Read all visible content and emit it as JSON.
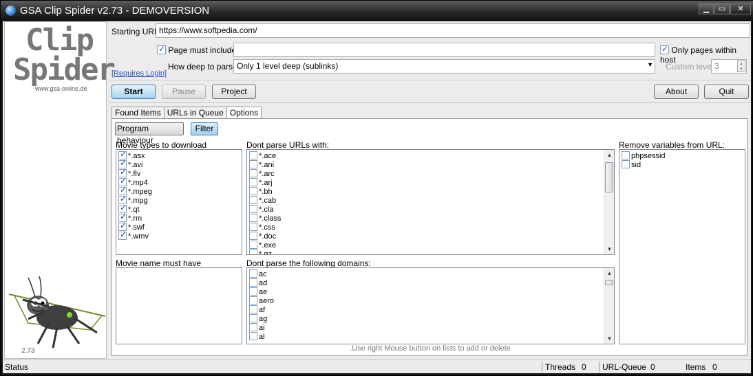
{
  "window": {
    "title": "GSA Clip Spider v2.73 - DEMOVERSION",
    "controls": [
      "minimize",
      "maximize",
      "close"
    ]
  },
  "logo": {
    "line1": "Clip",
    "line2": "Spider",
    "site": "www.gsa-online.de",
    "version": "2.73"
  },
  "settings": {
    "starting_url_label": "Starting URL",
    "starting_url_value": "https://www.softpedia.com/",
    "page_must_include_label": "Page must include",
    "page_must_include_checked": true,
    "page_must_include_value": "",
    "only_pages_within_host_label": "Only pages within host",
    "only_pages_within_host_checked": true,
    "requires_login_link": "[Requires Login]",
    "how_deep_label": "How deep to parse",
    "how_deep_value": "Only 1 level deep (sublinks)",
    "custom_level_label": "Custom level",
    "custom_level_value": "3"
  },
  "toolbar": {
    "start": "Start",
    "pause": "Pause",
    "project": "Project",
    "about": "About",
    "quit": "Quit"
  },
  "tabs": [
    {
      "label": "Found Items",
      "active": false
    },
    {
      "label": "URLs in Queue",
      "active": false
    },
    {
      "label": "Options",
      "active": true
    }
  ],
  "options": {
    "subtabs": [
      "Program behaviour",
      "Filter"
    ],
    "movie_types_label": "Movie types to download",
    "movie_types": [
      {
        "label": "*.asx",
        "checked": true
      },
      {
        "label": "*.avi",
        "checked": true
      },
      {
        "label": "*.flv",
        "checked": true
      },
      {
        "label": "*.mp4",
        "checked": true
      },
      {
        "label": "*.mpeg",
        "checked": true
      },
      {
        "label": "*.mpg",
        "checked": true
      },
      {
        "label": "*.qt",
        "checked": true
      },
      {
        "label": "*.rm",
        "checked": true
      },
      {
        "label": "*.swf",
        "checked": true
      },
      {
        "label": "*.wmv",
        "checked": true
      }
    ],
    "dont_parse_urls_label": "Dont parse URLs with:",
    "dont_parse_urls": [
      "*.ace",
      "*.ani",
      "*.arc",
      "*.arj",
      "*.bh",
      "*.cab",
      "*.cla",
      "*.class",
      "*.css",
      "*.doc",
      "*.exe",
      "*.gz"
    ],
    "remove_variables_label": "Remove variables from URL:",
    "remove_variables": [
      "phpsessid",
      "sid"
    ],
    "movie_name_label": "Movie name must have",
    "dont_parse_domains_label": "Dont parse the following domains:",
    "dont_parse_domains": [
      "ac",
      "ad",
      "ae",
      "aero",
      "af",
      "ag",
      "ai",
      "al"
    ],
    "hint": ".Use right Mouse button on lists to add or delete"
  },
  "status": {
    "status_label": "Status",
    "threads_label": "Threads",
    "threads_value": "0",
    "queue_label": "URL-Queue",
    "queue_value": "0",
    "items_label": "Items",
    "items_value": "0"
  },
  "colors": {
    "titlebar": "#2a2a2a",
    "accent": "#3c7fb1",
    "link": "#2a4fc0"
  }
}
